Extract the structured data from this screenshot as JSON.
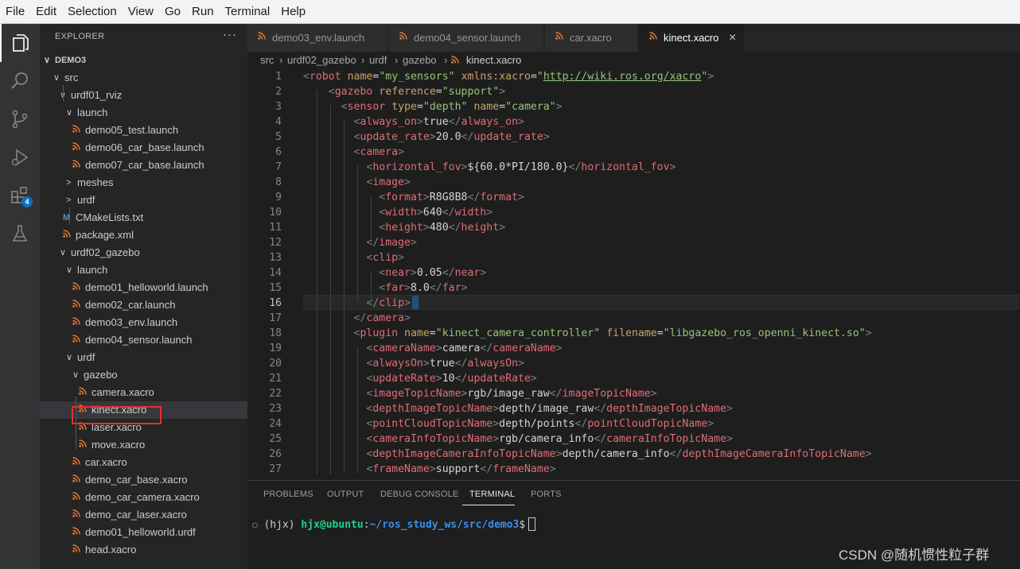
{
  "menu": [
    "File",
    "Edit",
    "Selection",
    "View",
    "Go",
    "Run",
    "Terminal",
    "Help"
  ],
  "activity": {
    "extensions_badge": "4"
  },
  "sidebar": {
    "header": "EXPLORER",
    "more": "···",
    "tree": [
      {
        "label": "DEMO3",
        "chev": "∨",
        "type": "root"
      },
      {
        "label": "src",
        "chev": "∨",
        "type": "folder"
      },
      {
        "label": "urdf01_rviz",
        "chev": "∨",
        "type": "folder"
      },
      {
        "label": "launch",
        "chev": "∨",
        "type": "folder"
      },
      {
        "label": "demo05_test.launch",
        "type": "rss"
      },
      {
        "label": "demo06_car_base.launch",
        "type": "rss"
      },
      {
        "label": "demo07_car_base.launch",
        "type": "rss"
      },
      {
        "label": "meshes",
        "chev": ">",
        "type": "folder"
      },
      {
        "label": "urdf",
        "chev": ">",
        "type": "folder"
      },
      {
        "label": "CMakeLists.txt",
        "type": "cmake",
        "icon": "M"
      },
      {
        "label": "package.xml",
        "type": "rss"
      },
      {
        "label": "urdf02_gazebo",
        "chev": "∨",
        "type": "folder"
      },
      {
        "label": "launch",
        "chev": "∨",
        "type": "folder"
      },
      {
        "label": "demo01_helloworld.launch",
        "type": "rss"
      },
      {
        "label": "demo02_car.launch",
        "type": "rss"
      },
      {
        "label": "demo03_env.launch",
        "type": "rss"
      },
      {
        "label": "demo04_sensor.launch",
        "type": "rss"
      },
      {
        "label": "urdf",
        "chev": "∨",
        "type": "folder"
      },
      {
        "label": "gazebo",
        "chev": "∨",
        "type": "folder"
      },
      {
        "label": "camera.xacro",
        "type": "rss"
      },
      {
        "label": "kinect.xacro",
        "type": "rss",
        "selected": true
      },
      {
        "label": "laser.xacro",
        "type": "rss"
      },
      {
        "label": "move.xacro",
        "type": "rss"
      },
      {
        "label": "car.xacro",
        "type": "rss"
      },
      {
        "label": "demo_car_base.xacro",
        "type": "rss"
      },
      {
        "label": "demo_car_camera.xacro",
        "type": "rss"
      },
      {
        "label": "demo_car_laser.xacro",
        "type": "rss"
      },
      {
        "label": "demo01_helloworld.urdf",
        "type": "rss"
      },
      {
        "label": "head.xacro",
        "type": "rss"
      }
    ]
  },
  "tabs": [
    {
      "label": "demo03_env.launch",
      "active": false
    },
    {
      "label": "demo04_sensor.launch",
      "active": false
    },
    {
      "label": "car.xacro",
      "active": false
    },
    {
      "label": "kinect.xacro",
      "active": true,
      "close": "×"
    }
  ],
  "breadcrumb": [
    "src",
    "urdf02_gazebo",
    "urdf",
    "gazebo",
    "kinect.xacro"
  ],
  "editor": {
    "current_line": 16,
    "lines": [
      [
        [
          "p",
          "<"
        ],
        [
          "t",
          "robot"
        ],
        [
          "d",
          " "
        ],
        [
          "a",
          "name"
        ],
        [
          "d",
          "="
        ],
        [
          "s",
          "\"my_sensors\""
        ],
        [
          "d",
          " "
        ],
        [
          "a",
          "xmlns:xacro"
        ],
        [
          "d",
          "="
        ],
        [
          "s",
          "\""
        ],
        [
          "u",
          "http://wiki.ros.org/xacro"
        ],
        [
          "s",
          "\""
        ],
        [
          "p",
          ">"
        ]
      ],
      [
        [
          "d",
          "    "
        ],
        [
          "p",
          "<"
        ],
        [
          "t",
          "gazebo"
        ],
        [
          "d",
          " "
        ],
        [
          "a",
          "reference"
        ],
        [
          "d",
          "="
        ],
        [
          "s",
          "\"support\""
        ],
        [
          "p",
          ">"
        ]
      ],
      [
        [
          "d",
          "      "
        ],
        [
          "p",
          "<"
        ],
        [
          "t",
          "sensor"
        ],
        [
          "d",
          " "
        ],
        [
          "a",
          "type"
        ],
        [
          "d",
          "="
        ],
        [
          "s",
          "\"depth\""
        ],
        [
          "d",
          " "
        ],
        [
          "a",
          "name"
        ],
        [
          "d",
          "="
        ],
        [
          "s",
          "\"camera\""
        ],
        [
          "p",
          ">"
        ]
      ],
      [
        [
          "d",
          "        "
        ],
        [
          "p",
          "<"
        ],
        [
          "t",
          "always_on"
        ],
        [
          "p",
          ">"
        ],
        [
          "d",
          "true"
        ],
        [
          "p",
          "</"
        ],
        [
          "t",
          "always_on"
        ],
        [
          "p",
          ">"
        ]
      ],
      [
        [
          "d",
          "        "
        ],
        [
          "p",
          "<"
        ],
        [
          "t",
          "update_rate"
        ],
        [
          "p",
          ">"
        ],
        [
          "d",
          "20.0"
        ],
        [
          "p",
          "</"
        ],
        [
          "t",
          "update_rate"
        ],
        [
          "p",
          ">"
        ]
      ],
      [
        [
          "d",
          "        "
        ],
        [
          "p",
          "<"
        ],
        [
          "t",
          "camera"
        ],
        [
          "p",
          ">"
        ]
      ],
      [
        [
          "d",
          "          "
        ],
        [
          "p",
          "<"
        ],
        [
          "t",
          "horizontal_fov"
        ],
        [
          "p",
          ">"
        ],
        [
          "d",
          "${60.0*PI/180.0}"
        ],
        [
          "p",
          "</"
        ],
        [
          "t",
          "horizontal_fov"
        ],
        [
          "p",
          ">"
        ]
      ],
      [
        [
          "d",
          "          "
        ],
        [
          "p",
          "<"
        ],
        [
          "t",
          "image"
        ],
        [
          "p",
          ">"
        ]
      ],
      [
        [
          "d",
          "            "
        ],
        [
          "p",
          "<"
        ],
        [
          "t",
          "format"
        ],
        [
          "p",
          ">"
        ],
        [
          "d",
          "R8G8B8"
        ],
        [
          "p",
          "</"
        ],
        [
          "t",
          "format"
        ],
        [
          "p",
          ">"
        ]
      ],
      [
        [
          "d",
          "            "
        ],
        [
          "p",
          "<"
        ],
        [
          "t",
          "width"
        ],
        [
          "p",
          ">"
        ],
        [
          "d",
          "640"
        ],
        [
          "p",
          "</"
        ],
        [
          "t",
          "width"
        ],
        [
          "p",
          ">"
        ]
      ],
      [
        [
          "d",
          "            "
        ],
        [
          "p",
          "<"
        ],
        [
          "t",
          "height"
        ],
        [
          "p",
          ">"
        ],
        [
          "d",
          "480"
        ],
        [
          "p",
          "</"
        ],
        [
          "t",
          "height"
        ],
        [
          "p",
          ">"
        ]
      ],
      [
        [
          "d",
          "          "
        ],
        [
          "p",
          "</"
        ],
        [
          "t",
          "image"
        ],
        [
          "p",
          ">"
        ]
      ],
      [
        [
          "d",
          "          "
        ],
        [
          "p",
          "<"
        ],
        [
          "t",
          "clip"
        ],
        [
          "p",
          ">"
        ]
      ],
      [
        [
          "d",
          "            "
        ],
        [
          "p",
          "<"
        ],
        [
          "t",
          "near"
        ],
        [
          "p",
          ">"
        ],
        [
          "d",
          "0.05"
        ],
        [
          "p",
          "</"
        ],
        [
          "t",
          "near"
        ],
        [
          "p",
          ">"
        ]
      ],
      [
        [
          "d",
          "            "
        ],
        [
          "p",
          "<"
        ],
        [
          "t",
          "far"
        ],
        [
          "p",
          ">"
        ],
        [
          "d",
          "8.0"
        ],
        [
          "p",
          "</"
        ],
        [
          "t",
          "far"
        ],
        [
          "p",
          ">"
        ]
      ],
      [
        [
          "d",
          "          "
        ],
        [
          "p",
          "</"
        ],
        [
          "t",
          "clip"
        ],
        [
          "p",
          ">"
        ]
      ],
      [
        [
          "d",
          "        "
        ],
        [
          "p",
          "</"
        ],
        [
          "t",
          "camera"
        ],
        [
          "p",
          ">"
        ]
      ],
      [
        [
          "d",
          "        "
        ],
        [
          "p",
          "<"
        ],
        [
          "t",
          "plugin"
        ],
        [
          "d",
          " "
        ],
        [
          "a",
          "name"
        ],
        [
          "d",
          "="
        ],
        [
          "s",
          "\"kinect_camera_controller\""
        ],
        [
          "d",
          " "
        ],
        [
          "a",
          "filename"
        ],
        [
          "d",
          "="
        ],
        [
          "s",
          "\"libgazebo_ros_openni_kinect.so\""
        ],
        [
          "p",
          ">"
        ]
      ],
      [
        [
          "d",
          "          "
        ],
        [
          "p",
          "<"
        ],
        [
          "t",
          "cameraName"
        ],
        [
          "p",
          ">"
        ],
        [
          "d",
          "camera"
        ],
        [
          "p",
          "</"
        ],
        [
          "t",
          "cameraName"
        ],
        [
          "p",
          ">"
        ]
      ],
      [
        [
          "d",
          "          "
        ],
        [
          "p",
          "<"
        ],
        [
          "t",
          "alwaysOn"
        ],
        [
          "p",
          ">"
        ],
        [
          "d",
          "true"
        ],
        [
          "p",
          "</"
        ],
        [
          "t",
          "alwaysOn"
        ],
        [
          "p",
          ">"
        ]
      ],
      [
        [
          "d",
          "          "
        ],
        [
          "p",
          "<"
        ],
        [
          "t",
          "updateRate"
        ],
        [
          "p",
          ">"
        ],
        [
          "d",
          "10"
        ],
        [
          "p",
          "</"
        ],
        [
          "t",
          "updateRate"
        ],
        [
          "p",
          ">"
        ]
      ],
      [
        [
          "d",
          "          "
        ],
        [
          "p",
          "<"
        ],
        [
          "t",
          "imageTopicName"
        ],
        [
          "p",
          ">"
        ],
        [
          "d",
          "rgb/image_raw"
        ],
        [
          "p",
          "</"
        ],
        [
          "t",
          "imageTopicName"
        ],
        [
          "p",
          ">"
        ]
      ],
      [
        [
          "d",
          "          "
        ],
        [
          "p",
          "<"
        ],
        [
          "t",
          "depthImageTopicName"
        ],
        [
          "p",
          ">"
        ],
        [
          "d",
          "depth/image_raw"
        ],
        [
          "p",
          "</"
        ],
        [
          "t",
          "depthImageTopicName"
        ],
        [
          "p",
          ">"
        ]
      ],
      [
        [
          "d",
          "          "
        ],
        [
          "p",
          "<"
        ],
        [
          "t",
          "pointCloudTopicName"
        ],
        [
          "p",
          ">"
        ],
        [
          "d",
          "depth/points"
        ],
        [
          "p",
          "</"
        ],
        [
          "t",
          "pointCloudTopicName"
        ],
        [
          "p",
          ">"
        ]
      ],
      [
        [
          "d",
          "          "
        ],
        [
          "p",
          "<"
        ],
        [
          "t",
          "cameraInfoTopicName"
        ],
        [
          "p",
          ">"
        ],
        [
          "d",
          "rgb/camera_info"
        ],
        [
          "p",
          "</"
        ],
        [
          "t",
          "cameraInfoTopicName"
        ],
        [
          "p",
          ">"
        ]
      ],
      [
        [
          "d",
          "          "
        ],
        [
          "p",
          "<"
        ],
        [
          "t",
          "depthImageCameraInfoTopicName"
        ],
        [
          "p",
          ">"
        ],
        [
          "d",
          "depth/camera_info"
        ],
        [
          "p",
          "</"
        ],
        [
          "t",
          "depthImageCameraInfoTopicName"
        ],
        [
          "p",
          ">"
        ]
      ],
      [
        [
          "d",
          "          "
        ],
        [
          "p",
          "<"
        ],
        [
          "t",
          "frameName"
        ],
        [
          "p",
          ">"
        ],
        [
          "d",
          "support"
        ],
        [
          "p",
          "</"
        ],
        [
          "t",
          "frameName"
        ],
        [
          "p",
          ">"
        ]
      ]
    ]
  },
  "panel": {
    "tabs": [
      "PROBLEMS",
      "OUTPUT",
      "DEBUG CONSOLE",
      "TERMINAL",
      "PORTS"
    ],
    "active_tab": "TERMINAL",
    "terminal": {
      "dot": "○",
      "env": "(hjx)",
      "user": "hjx@ubuntu",
      "sep": ":",
      "path": "~/ros_study_ws/src/demo3",
      "prompt": "$"
    }
  },
  "watermark": "CSDN @随机惯性粒子群"
}
